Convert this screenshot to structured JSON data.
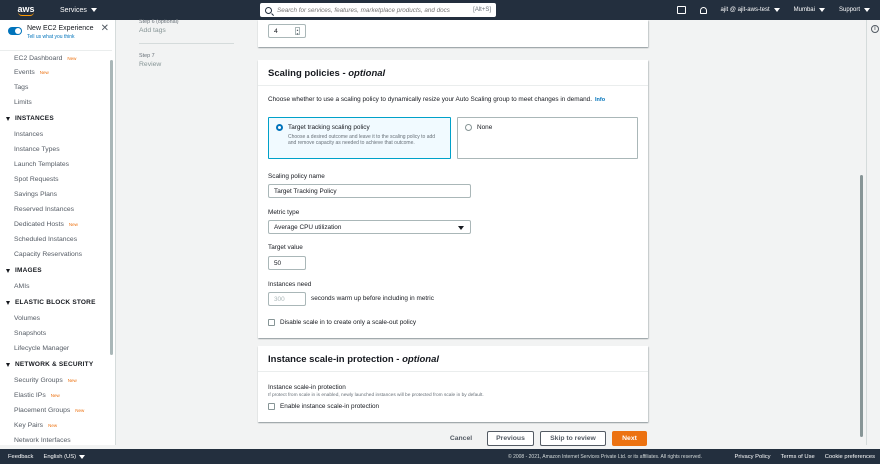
{
  "topnav": {
    "logo": "aws",
    "services": "Services",
    "search_placeholder": "Search for services, features, marketplace products, and docs",
    "search_shortcut": "[Alt+S]",
    "user": "ajit @ ajit-aws-test",
    "region": "Mumbai",
    "support": "Support"
  },
  "sidebar": {
    "experience_title": "New EC2 Experience",
    "experience_link": "Tell us what you think",
    "top_items": [
      {
        "label": "EC2 Dashboard",
        "new": "New"
      },
      {
        "label": "Events",
        "new": "New"
      },
      {
        "label": "Tags",
        "new": ""
      },
      {
        "label": "Limits",
        "new": ""
      }
    ],
    "instances_header": "INSTANCES",
    "instances": [
      {
        "label": "Instances",
        "new": ""
      },
      {
        "label": "Instance Types",
        "new": ""
      },
      {
        "label": "Launch Templates",
        "new": ""
      },
      {
        "label": "Spot Requests",
        "new": ""
      },
      {
        "label": "Savings Plans",
        "new": ""
      },
      {
        "label": "Reserved Instances",
        "new": ""
      },
      {
        "label": "Dedicated Hosts",
        "new": "New"
      },
      {
        "label": "Scheduled Instances",
        "new": ""
      },
      {
        "label": "Capacity Reservations",
        "new": ""
      }
    ],
    "images_header": "IMAGES",
    "images": [
      {
        "label": "AMIs",
        "new": ""
      }
    ],
    "ebs_header": "ELASTIC BLOCK STORE",
    "ebs": [
      {
        "label": "Volumes",
        "new": ""
      },
      {
        "label": "Snapshots",
        "new": ""
      },
      {
        "label": "Lifecycle Manager",
        "new": ""
      }
    ],
    "network_header": "NETWORK & SECURITY",
    "network": [
      {
        "label": "Security Groups",
        "new": "New"
      },
      {
        "label": "Elastic IPs",
        "new": "New"
      },
      {
        "label": "Placement Groups",
        "new": "New"
      },
      {
        "label": "Key Pairs",
        "new": "New"
      },
      {
        "label": "Network Interfaces",
        "new": ""
      }
    ]
  },
  "steps": {
    "step6_num": "Step 6 (optional)",
    "step6_title": "Add tags",
    "step7_num": "Step 7",
    "step7_title": "Review"
  },
  "top_panel": {
    "stepper_value": "4"
  },
  "scaling": {
    "title": "Scaling policies - ",
    "title_opt": "optional",
    "description": "Choose whether to use a scaling policy to dynamically resize your Auto Scaling group to meet changes in demand.",
    "info": "Info",
    "option_tracking": "Target tracking scaling policy",
    "option_tracking_desc": "Choose a desired outcome and leave it to the scaling policy to add and remove capacity as needed to achieve that outcome.",
    "option_none": "None",
    "policy_name_label": "Scaling policy name",
    "policy_name_value": "Target Tracking Policy",
    "metric_label": "Metric type",
    "metric_value": "Average CPU utilization",
    "target_label": "Target value",
    "target_value": "50",
    "warmup_label": "Instances need",
    "warmup_placeholder": "300",
    "warmup_suffix": "seconds warm up before including in metric",
    "disable_scale_in": "Disable scale in to create only a scale-out policy"
  },
  "protection": {
    "title": "Instance scale-in protection - ",
    "title_opt": "optional",
    "label": "Instance scale-in protection",
    "help": "If protect from scale in is enabled, newly launched instances will be protected from scale in by default.",
    "checkbox": "Enable instance scale-in protection"
  },
  "actions": {
    "cancel": "Cancel",
    "previous": "Previous",
    "skip": "Skip to review",
    "next": "Next"
  },
  "footer": {
    "feedback": "Feedback",
    "language": "English (US)",
    "copyright": "© 2008 - 2021, Amazon Internet Services Private Ltd. or its affiliates. All rights reserved.",
    "privacy": "Privacy Policy",
    "terms": "Terms of Use",
    "cookies": "Cookie preferences"
  },
  "colors": {
    "accent": "#0073bb",
    "primary_button": "#ec7211",
    "nav_bg": "#232f3e"
  }
}
